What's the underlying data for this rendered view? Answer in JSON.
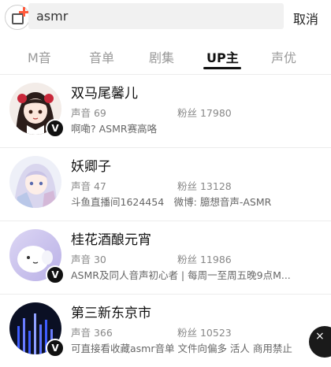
{
  "search": {
    "query": "asmr",
    "cancel_label": "取消"
  },
  "tabs": [
    {
      "label": "M音",
      "active": false
    },
    {
      "label": "音单",
      "active": false
    },
    {
      "label": "剧集",
      "active": false
    },
    {
      "label": "UP主",
      "active": true
    },
    {
      "label": "声优",
      "active": false
    }
  ],
  "results": [
    {
      "name": "双马尾馨儿",
      "sounds_label": "声音 69",
      "fans_label": "粉丝 17980",
      "desc": "啊嘞? ASMR赛高咯",
      "verified": "V"
    },
    {
      "name": "妖卿子",
      "sounds_label": "声音 47",
      "fans_label": "粉丝 13128",
      "desc": "斗鱼直播间1624454　微博: 臆想音声-ASMR",
      "verified": ""
    },
    {
      "name": "桂花酒酿元宵",
      "sounds_label": "声音 30",
      "fans_label": "粉丝 11986",
      "desc": "ASMR及同人音声初心者 | 每周一至周五晚9点M...",
      "verified": "V"
    },
    {
      "name": "第三新东京市",
      "sounds_label": "声音 366",
      "fans_label": "粉丝 10523",
      "desc": "可直接看收藏asmr音单 文件向偏多 活人 商用禁止",
      "verified": "V"
    }
  ],
  "overlay": {
    "close_glyph": "×"
  }
}
